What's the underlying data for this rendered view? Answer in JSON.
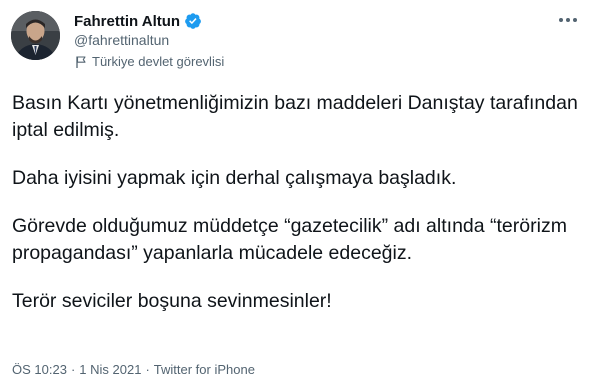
{
  "author": {
    "display_name": "Fahrettin Altun",
    "handle": "@fahrettinaltun",
    "affiliation": "Türkiye devlet görevlisi",
    "verified": true
  },
  "tweet": {
    "paragraphs": [
      "Basın Kartı yönetmenliğimizin bazı maddeleri Danıştay tarafından iptal edilmiş.",
      "Daha iyisini yapmak için derhal çalışmaya başladık.",
      "Görevde olduğumuz müddetçe “gazetecilik” adı altında “terörizm propagandası” yapanlarla mücadele edeceğiz.",
      "Terör seviciler boşuna sevinmesinler!"
    ],
    "time": "ÖS 10:23",
    "date": "1 Nis 2021",
    "separator": "·",
    "source": "Twitter for iPhone"
  },
  "colors": {
    "text_primary": "#0f1419",
    "text_secondary": "#536471",
    "verified_blue": "#1d9bf0"
  },
  "icons": {
    "verified": "verified-badge-icon",
    "affiliation": "flag-icon",
    "more": "more-dots-icon"
  }
}
